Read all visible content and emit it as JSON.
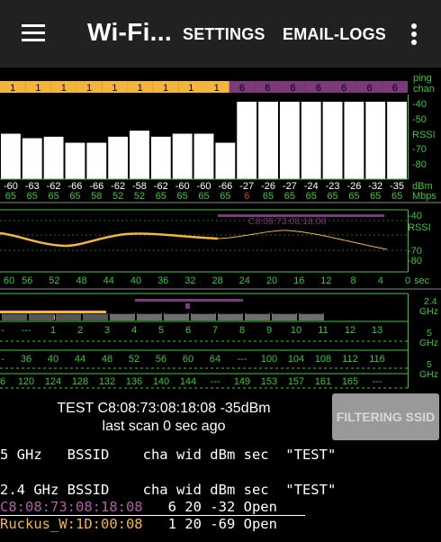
{
  "appbar": {
    "title": "Wi-Fi...",
    "settings_label": "SETTINGS",
    "email_logs_label": "EMAIL-LOGS",
    "menu_icon": "hamburger-menu-icon",
    "overflow_icon": "more-vert-icon",
    "background": "#212121"
  },
  "colors": {
    "yellow": "#f4b53e",
    "purple": "#7d3a7b",
    "green": "#3fc63f",
    "red": "#e53935",
    "gray": "#6d6d6d"
  },
  "channel_graph": {
    "right_labels": [
      "ping",
      "chan"
    ],
    "bands": [
      {
        "label": "1",
        "count": 9,
        "color": "yellow"
      },
      {
        "label": "6",
        "count": 7,
        "color": "purple"
      }
    ],
    "axis_labels": [
      "-40",
      "-50",
      "RSSI",
      "-70",
      "-80"
    ],
    "unit_labels": [
      "dBm",
      "Mbps"
    ],
    "rssi": [
      "-60",
      "-63",
      "-62",
      "-66",
      "-66",
      "-62",
      "-58",
      "-62",
      "-60",
      "-60",
      "-66",
      "-27",
      "-26",
      "-27",
      "-24",
      "-23",
      "-26",
      "-32",
      "-35"
    ],
    "mbps": [
      "65",
      "65",
      "65",
      "65",
      "58",
      "52",
      "52",
      "65",
      "65",
      "65",
      "65",
      "6",
      "65",
      "65",
      "65",
      "65",
      "65",
      "65",
      "65"
    ]
  },
  "history_graph": {
    "ssid_label": "C8:08:73:08:18:08",
    "axis_labels": [
      "-40",
      "RSSI",
      "-70",
      "-80"
    ],
    "sec_ticks": [
      "60",
      "56",
      "52",
      "48",
      "44",
      "40",
      "36",
      "32",
      "28",
      "24",
      "20",
      "16",
      "12",
      "8",
      "4",
      "0"
    ],
    "unit_label": "sec"
  },
  "band_graph": {
    "band_labels": [
      "2.4",
      "GHz",
      "5",
      "GHz",
      "5",
      "GHz"
    ],
    "ch24": [
      "-",
      "---",
      "1",
      "2",
      "3",
      "4",
      "5",
      "6",
      "7",
      "8",
      "9",
      "10",
      "11",
      "12",
      "13"
    ],
    "ch5a": [
      "-",
      "36",
      "40",
      "44",
      "48",
      "52",
      "56",
      "60",
      "64",
      "---",
      "100",
      "104",
      "108",
      "112",
      "116"
    ],
    "ch5b": [
      "6",
      "120",
      "124",
      "128",
      "132",
      "136",
      "140",
      "144",
      "---",
      "149",
      "153",
      "157",
      "161",
      "165",
      "---"
    ]
  },
  "status": {
    "line1": "TEST   C8:08:73:08:18:08   -35dBm",
    "line2": "last scan 0 sec ago",
    "filter_button": "FILTERING SSID"
  },
  "list": {
    "header5": "5 GHz   BSSID    cha wid dBm sec  \"TEST\"",
    "header24": "2.4 GHz BSSID    cha wid dBm sec  \"TEST\"",
    "rows": [
      {
        "bssid": "C8:08:73:08:18:08",
        "info": "   6 20 -32 Open"
      },
      {
        "bssid": "Ruckus_W:1D:00:08",
        "info": "   1 20 -69 Open"
      }
    ]
  }
}
